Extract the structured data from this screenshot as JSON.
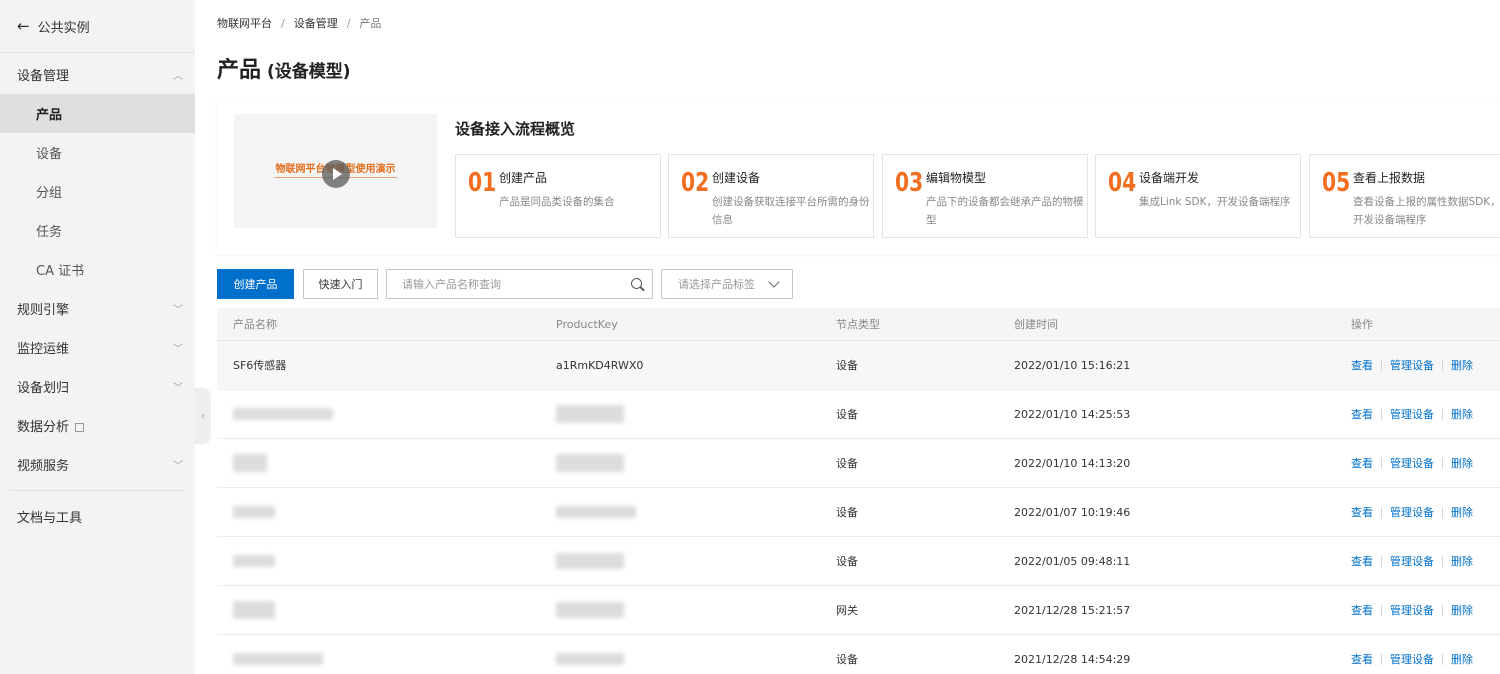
{
  "sidebar": {
    "back_label": "公共实例",
    "groups": [
      {
        "label": "设备管理",
        "expanded": true
      },
      {
        "label": "规则引擎"
      },
      {
        "label": "监控运维"
      },
      {
        "label": "设备划归"
      },
      {
        "label": "数据分析"
      },
      {
        "label": "视频服务"
      },
      {
        "label": "文档与工具"
      }
    ],
    "items": [
      {
        "label": "产品",
        "active": true
      },
      {
        "label": "设备"
      },
      {
        "label": "分组"
      },
      {
        "label": "任务"
      },
      {
        "label": "CA 证书"
      }
    ]
  },
  "breadcrumb": [
    "物联网平台",
    "设备管理",
    "产品"
  ],
  "page": {
    "title": "产品",
    "subtitle": "(设备模型)"
  },
  "flow": {
    "video_text": "物联网平台物模型使用演示",
    "title": "设备接入流程概览",
    "steps": [
      {
        "num": "01",
        "title": "创建产品",
        "desc": "产品是同品类设备的集合"
      },
      {
        "num": "02",
        "title": "创建设备",
        "desc": "创建设备获取连接平台所需的身份信息"
      },
      {
        "num": "03",
        "title": "编辑物模型",
        "desc": "产品下的设备都会继承产品的物模型"
      },
      {
        "num": "04",
        "title": "设备端开发",
        "desc": "集成Link SDK，开发设备端程序"
      },
      {
        "num": "05",
        "title": "查看上报数据",
        "desc": "查看设备上报的属性数据SDK，开发设备端程序"
      }
    ]
  },
  "toolbar": {
    "create_label": "创建产品",
    "quickstart_label": "快速入门",
    "search_placeholder": "请输入产品名称查询",
    "tag_placeholder": "请选择产品标签"
  },
  "table": {
    "headers": [
      "产品名称",
      "ProductKey",
      "节点类型",
      "创建时间",
      "操作"
    ],
    "rows": [
      {
        "name": "SF6传感器",
        "key": "a1RmKD4RWX0",
        "type": "设备",
        "time": "2022/01/10 15:16:21"
      },
      {
        "name": "",
        "key": "",
        "type": "设备",
        "time": "2022/01/10 14:25:53"
      },
      {
        "name": "",
        "key": "",
        "type": "设备",
        "time": "2022/01/10 14:13:20"
      },
      {
        "name": "",
        "key": "",
        "type": "设备",
        "time": "2022/01/07 10:19:46"
      },
      {
        "name": "",
        "key": "",
        "type": "设备",
        "time": "2022/01/05 09:48:11"
      },
      {
        "name": "",
        "key": "",
        "type": "网关",
        "time": "2021/12/28 15:21:57"
      },
      {
        "name": "",
        "key": "",
        "type": "设备",
        "time": "2021/12/28 14:54:29"
      }
    ],
    "actions": {
      "view": "查看",
      "manage": "管理设备",
      "delete": "删除"
    }
  },
  "colors": {
    "primary": "#0070cc",
    "accent": "#f26f21",
    "sidebar_bg": "#f2f3f5"
  }
}
